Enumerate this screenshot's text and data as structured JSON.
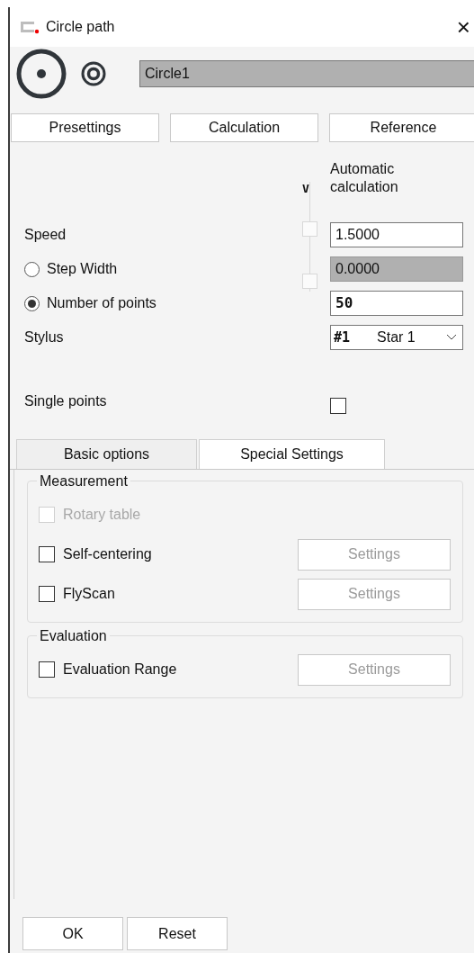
{
  "window": {
    "title": "Circle path",
    "close": "×"
  },
  "name_field": {
    "value": "Circle1"
  },
  "top_buttons": [
    "Presettings",
    "Calculation",
    "Reference"
  ],
  "auto_header": {
    "marker": "V",
    "label": "Automatic calculation"
  },
  "auto_boxes": [
    {
      "checked": false
    },
    {
      "checked": false
    }
  ],
  "rows": [
    {
      "kind": "label",
      "label": "Speed",
      "value": "1.5000",
      "disabled": false
    },
    {
      "kind": "radio",
      "label": "Step Width",
      "selected": false,
      "value": "0.0000",
      "disabled": true
    },
    {
      "kind": "radio",
      "label": "Number of points",
      "selected": true,
      "value": "50",
      "disabled": false
    }
  ],
  "stylus": {
    "label": "Stylus",
    "number": "#1",
    "value": "Star 1"
  },
  "single_points": {
    "label": "Single points",
    "checked": false
  },
  "tabs": [
    {
      "label": "Basic options",
      "selected": false
    },
    {
      "label": "Special Settings",
      "selected": true
    }
  ],
  "groups": [
    {
      "title": "Measurement",
      "items": [
        {
          "label": "Rotary table",
          "checked": false,
          "disabled": true
        },
        {
          "label": "Self-centering",
          "checked": false,
          "disabled": false,
          "button": "Settings"
        },
        {
          "label": "FlyScan",
          "checked": false,
          "disabled": false,
          "button": "Settings"
        }
      ]
    },
    {
      "title": "Evaluation",
      "items": [
        {
          "label": "Evaluation Range",
          "checked": false,
          "disabled": false,
          "button": "Settings"
        }
      ]
    }
  ],
  "footer_buttons": [
    "OK",
    "Reset"
  ]
}
